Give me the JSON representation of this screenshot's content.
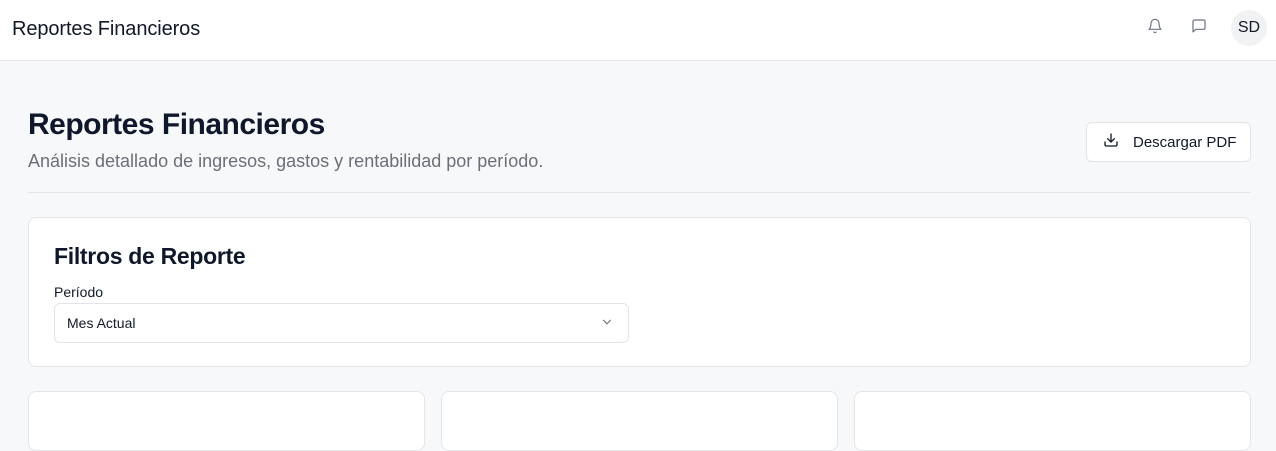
{
  "header": {
    "app_title": "Reportes Financieros",
    "icons": [
      "bell-icon",
      "message-icon"
    ],
    "avatar_initials": "SD"
  },
  "page": {
    "title": "Reportes Financieros",
    "subtitle": "Análisis detallado de ingresos, gastos y rentabilidad por período.",
    "download_label": "Descargar PDF"
  },
  "filters": {
    "title": "Filtros de Reporte",
    "period_label": "Período",
    "period_value": "Mes Actual"
  },
  "colors": {
    "background": "#f7f8fa",
    "surface": "#ffffff",
    "border": "#e3e5e8",
    "text_primary": "#0f172a",
    "text_muted": "#6b6f76"
  }
}
